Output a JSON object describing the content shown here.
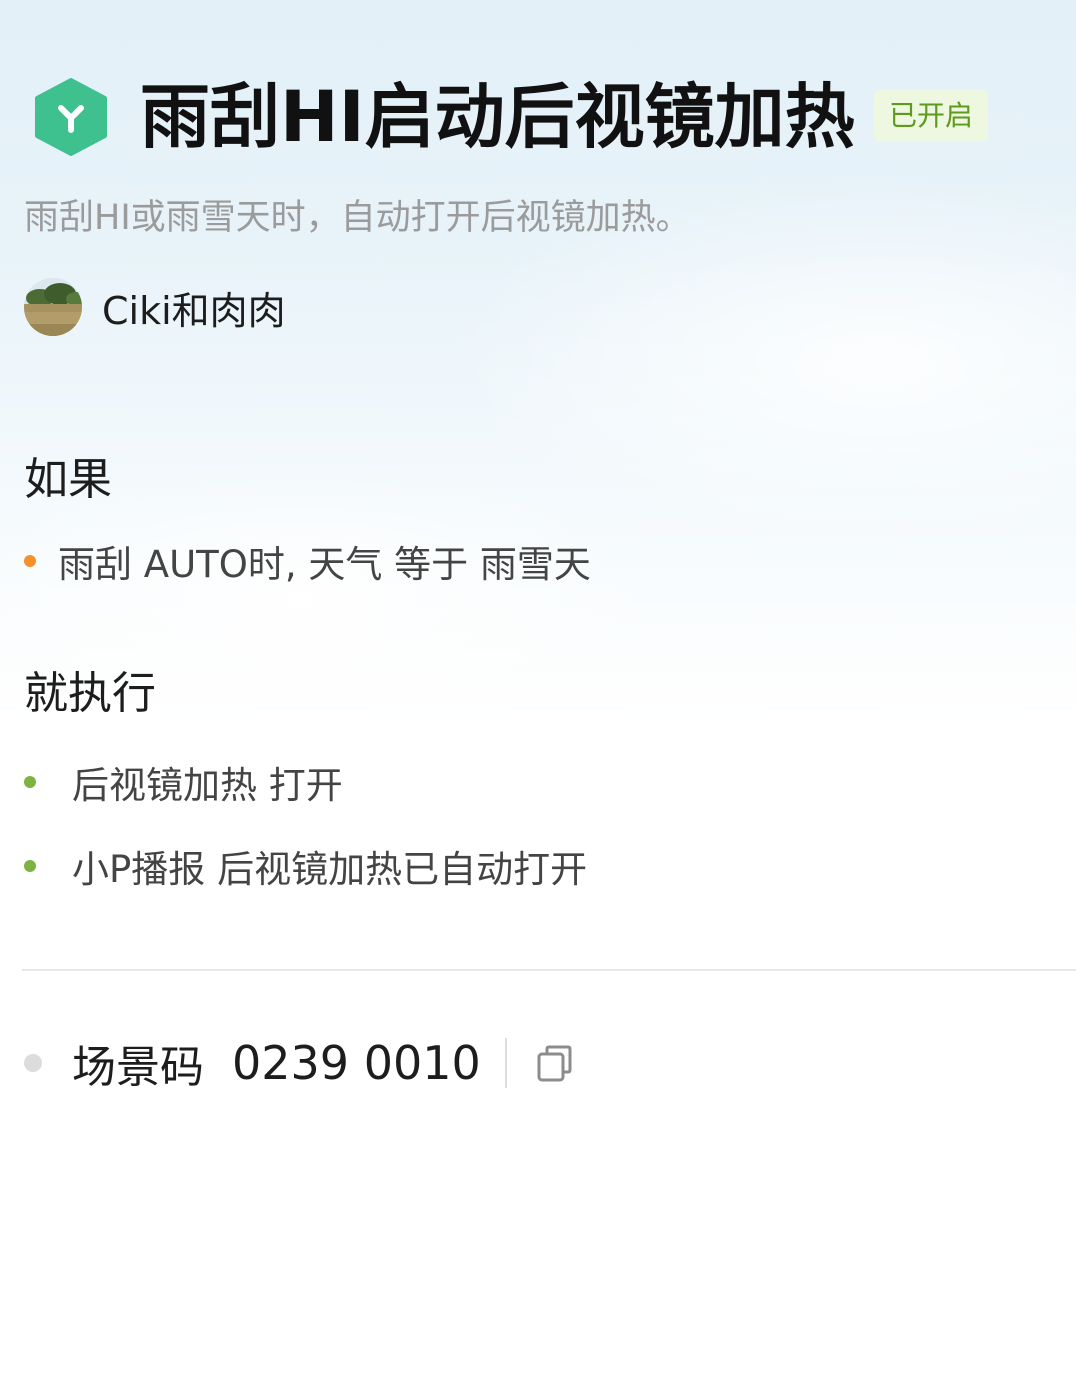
{
  "header": {
    "app_icon": "y-hexagon-icon",
    "title": "雨刮HI启动后视镜加热",
    "status_badge": "已开启",
    "description": "雨刮HI或雨雪天时，自动打开后视镜加热。"
  },
  "author": {
    "avatar": "landscape-avatar",
    "name": "Ciki和肉肉"
  },
  "if_section": {
    "title": "如果",
    "conditions": [
      {
        "text": "雨刮 AUTO时, 天气 等于 雨雪天"
      }
    ]
  },
  "then_section": {
    "title": "就执行",
    "actions": [
      {
        "text": "后视镜加热 打开"
      },
      {
        "text": "小P播报 后视镜加热已自动打开"
      }
    ]
  },
  "scene_code": {
    "label": "场景码",
    "value": "0239 0010",
    "copy_icon": "copy-icon"
  },
  "colors": {
    "brand_green": "#3ec18f",
    "badge_text": "#5e9a1e",
    "badge_bg": "#eef7df",
    "condition_dot": "#f3922d",
    "action_dot": "#7cb342"
  }
}
